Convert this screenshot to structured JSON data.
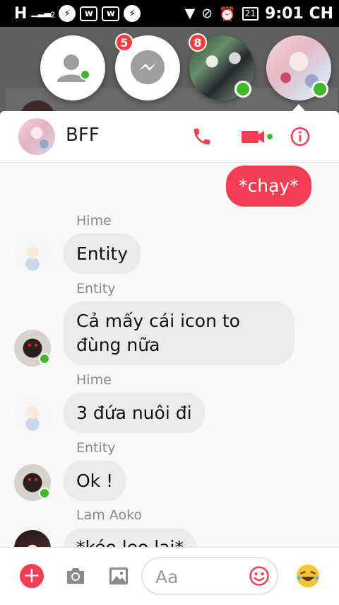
{
  "status_bar": {
    "left_signal": "H",
    "signal_sub": "2",
    "battery": "21",
    "time": "9:01 CH"
  },
  "chat_heads": [
    {
      "name": "contacts-head",
      "badge": ""
    },
    {
      "name": "messenger-head",
      "badge": "5"
    },
    {
      "name": "group-head",
      "badge": "8"
    },
    {
      "name": "bff-head",
      "badge": ""
    }
  ],
  "conversation": {
    "title": "BFF",
    "accent_color": "#f43d53"
  },
  "messages": [
    {
      "sender": "",
      "text": "*chạy*",
      "outgoing": true
    },
    {
      "sender": "Hime",
      "text": "Entity"
    },
    {
      "sender": "Entity",
      "text": "Cả mấy cái icon to đùng nữa"
    },
    {
      "sender": "Hime",
      "text": "3 đứa nuôi đi"
    },
    {
      "sender": "Entity",
      "text": "Ok !"
    },
    {
      "sender": "Lam Aoko",
      "text": "*kéo leo lại*"
    }
  ],
  "composer": {
    "placeholder": "Aa"
  },
  "icons": {
    "phone": "phone-icon",
    "video": "video-camera-icon",
    "info": "info-icon",
    "add": "plus-icon",
    "camera": "camera-icon",
    "gallery": "image-icon",
    "emoji": "smiley-icon",
    "reaction": "laughing-emoji-icon"
  }
}
